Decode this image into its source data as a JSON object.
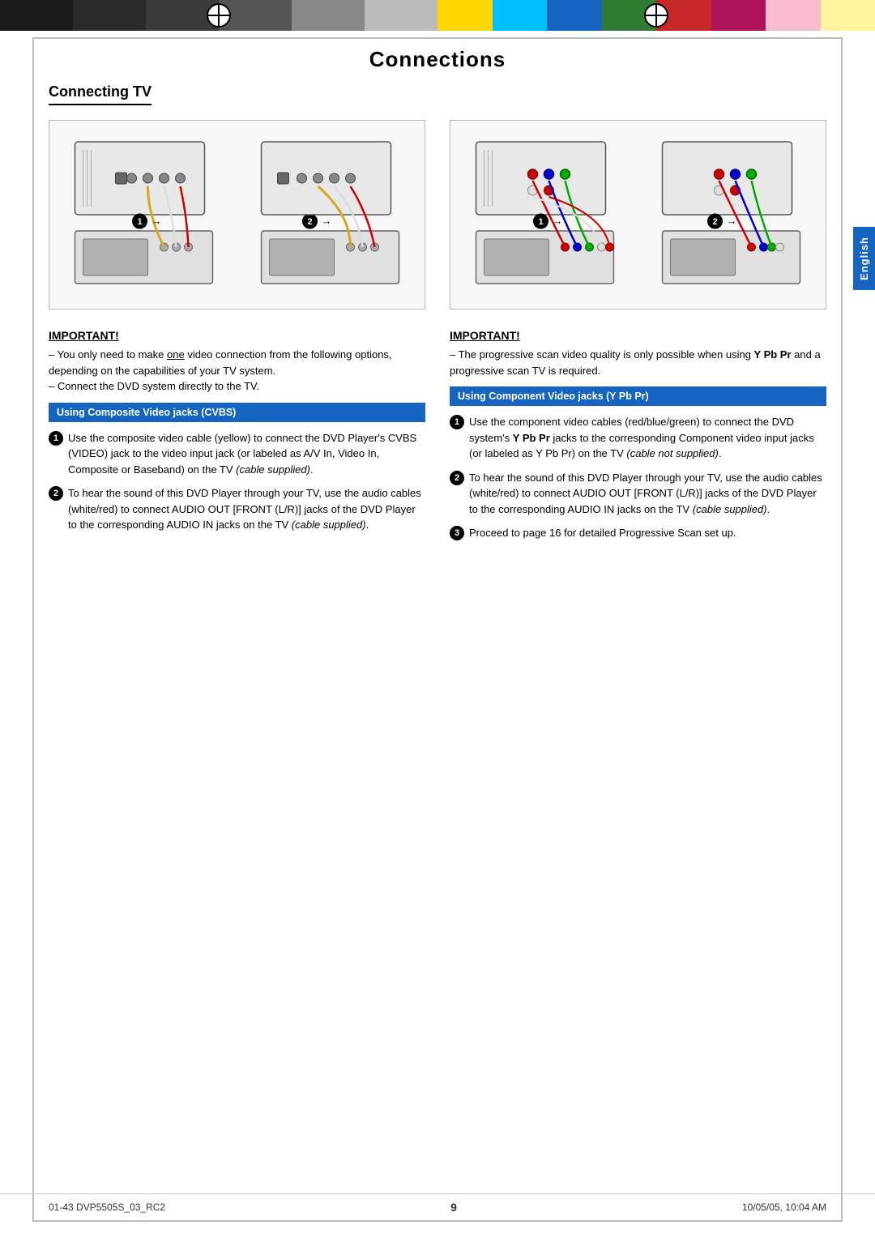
{
  "topbar": {
    "left_colors": [
      "#1a1a1a",
      "#2a2a2a",
      "#3a3a3a",
      "#555",
      "#888",
      "#bbb"
    ],
    "right_colors": [
      "#FFD700",
      "#00BFFF",
      "#1565C0",
      "#2E7D32",
      "#C62828",
      "#AD1457",
      "#F8BBD0",
      "#FFF59D"
    ]
  },
  "page": {
    "title": "Connections",
    "section_heading": "Connecting TV",
    "english_tab": "English",
    "page_number": "9"
  },
  "left_col": {
    "important_label": "IMPORTANT!",
    "important_lines": [
      "– You only need to make one video connection from the following options, depending on the capabilities of your TV system.",
      "– Connect the DVD system directly to the TV."
    ],
    "blue_heading": "Using Composite Video jacks (CVBS)",
    "items": [
      {
        "num": "1",
        "text": "Use the composite video cable (yellow) to connect the DVD Player's CVBS (VIDEO) jack to the video input jack (or labeled as A/V In, Video In, Composite or Baseband) on the TV (cable supplied)."
      },
      {
        "num": "2",
        "text": "To hear the sound of this DVD Player through your TV, use the audio cables (white/red) to connect AUDIO OUT [FRONT (L/R)] jacks of the DVD Player to the corresponding AUDIO IN jacks on the TV (cable supplied)."
      }
    ]
  },
  "right_col": {
    "important_label": "IMPORTANT!",
    "important_lines": [
      "– The progressive scan video quality is only possible when using Y Pb Pr and a progressive scan TV is required."
    ],
    "blue_heading": "Using Component Video jacks (Y Pb Pr)",
    "items": [
      {
        "num": "1",
        "text": "Use the component video cables (red/blue/green) to connect the DVD system's Y Pb Pr jacks to the corresponding Component video input jacks (or labeled as Y Pb Pr) on the TV (cable not supplied)."
      },
      {
        "num": "2",
        "text": "To hear the sound of this DVD Player through your TV, use the audio cables (white/red) to connect AUDIO OUT [FRONT (L/R)] jacks of the DVD Player to the corresponding AUDIO IN jacks on the TV (cable supplied)."
      },
      {
        "num": "3",
        "text": "Proceed to page 16 for detailed Progressive Scan set up."
      }
    ]
  },
  "footer": {
    "left": "01-43 DVP5505S_03_RC2",
    "center": "9",
    "right": "10/05/05, 10:04 AM"
  }
}
